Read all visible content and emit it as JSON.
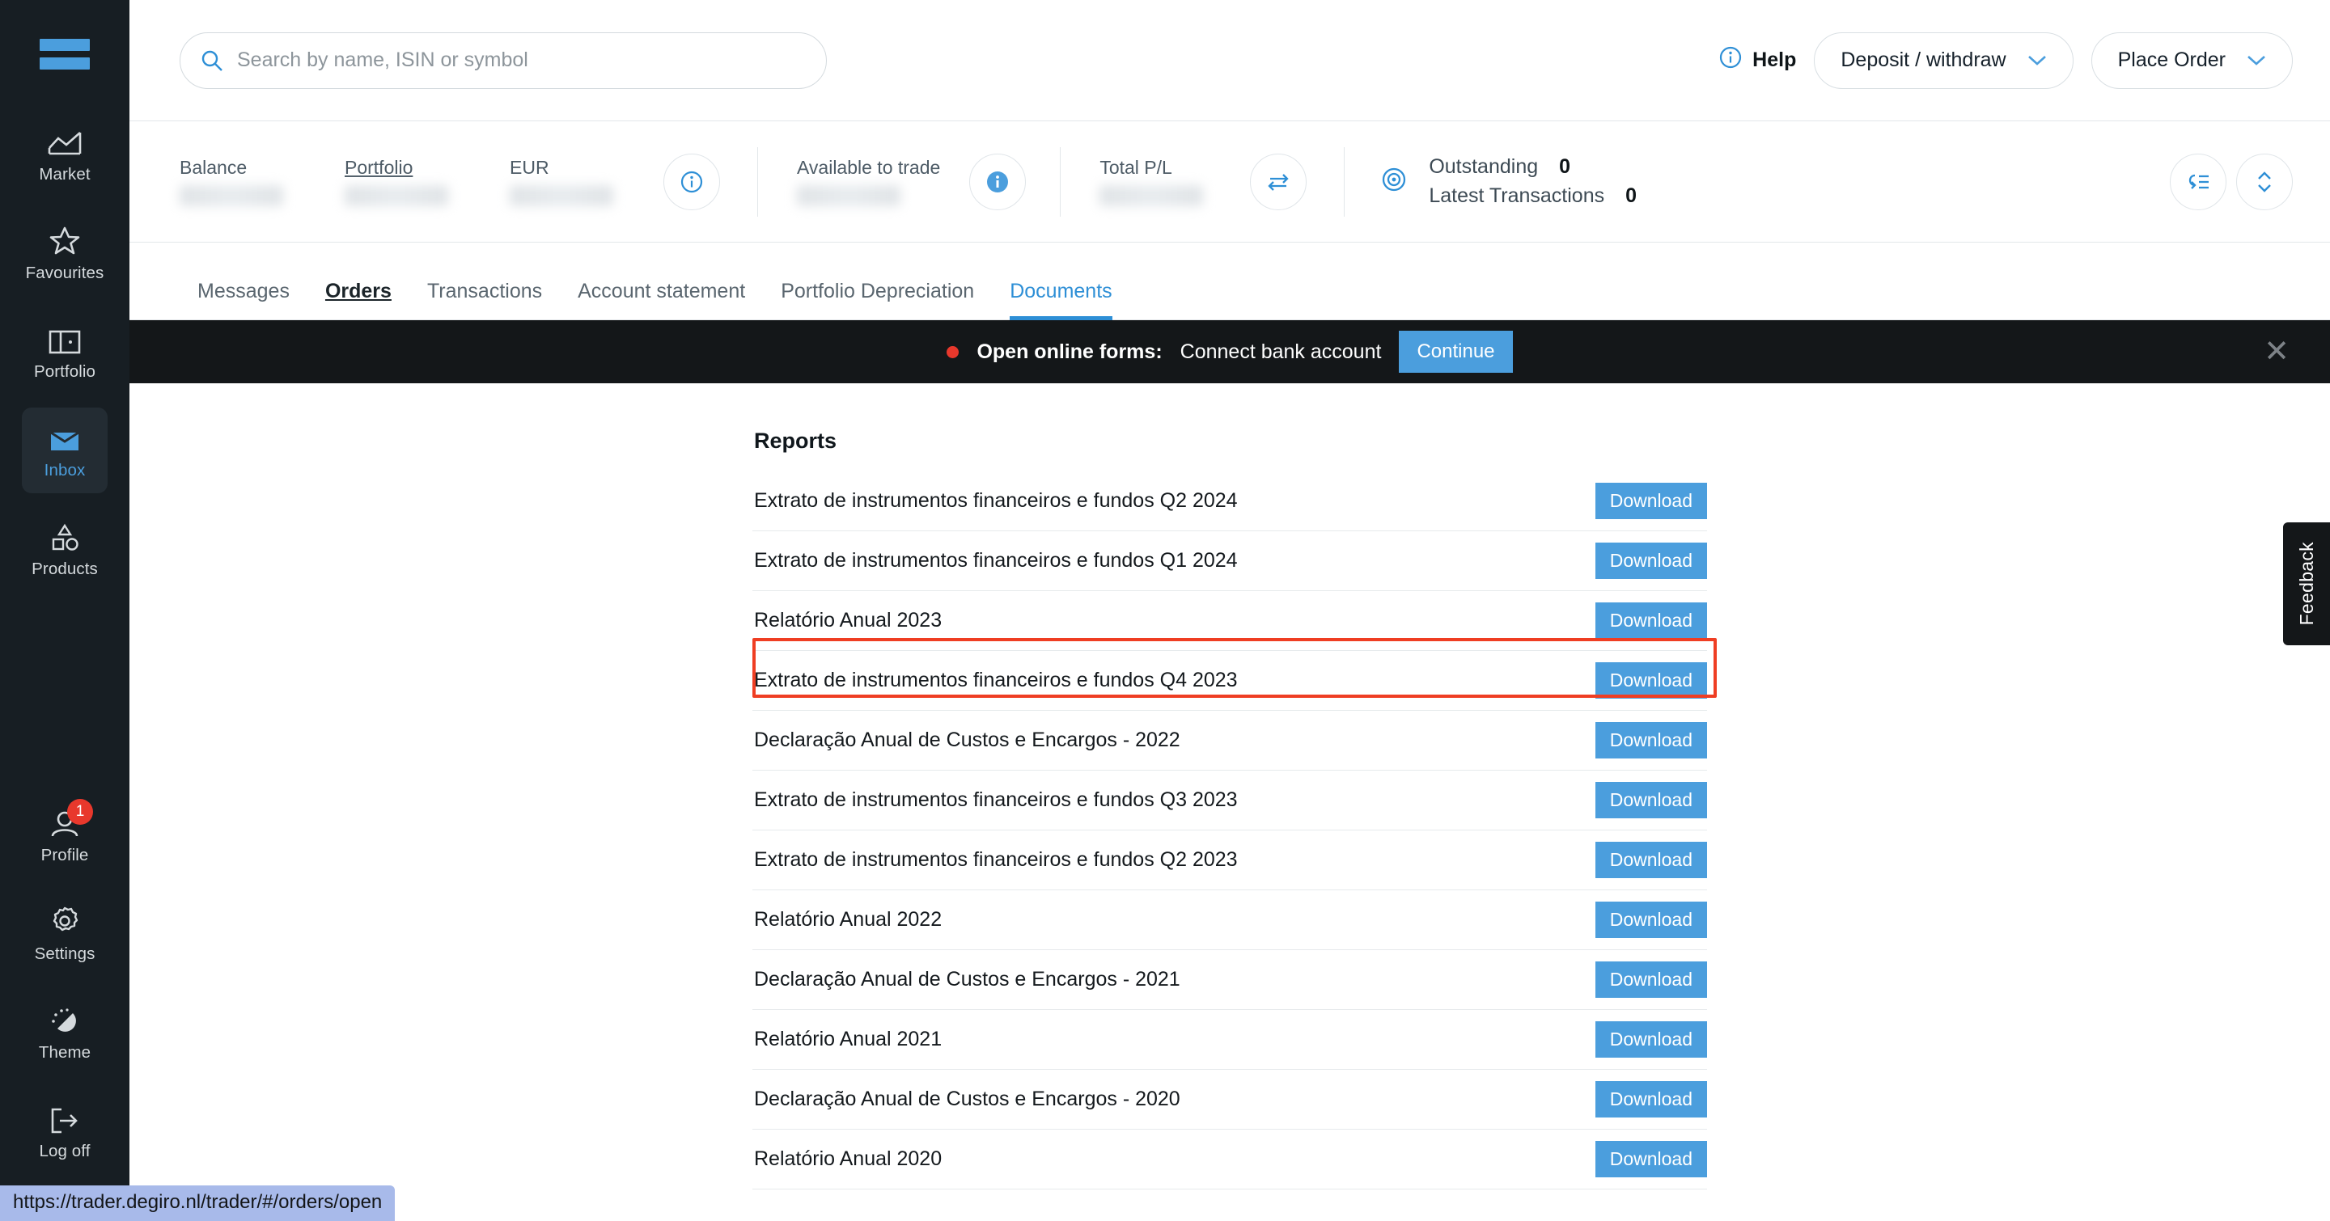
{
  "sidebar": {
    "logo_name": "degiro-logo",
    "top_items": [
      {
        "label": "Market",
        "icon": "market-chart-icon",
        "active": false
      },
      {
        "label": "Favourites",
        "icon": "star-icon",
        "active": false
      },
      {
        "label": "Portfolio",
        "icon": "portfolio-panel-icon",
        "active": false
      },
      {
        "label": "Inbox",
        "icon": "inbox-envelope-icon",
        "active": true
      },
      {
        "label": "Products",
        "icon": "products-shapes-icon",
        "active": false
      }
    ],
    "bottom_items": [
      {
        "label": "Profile",
        "icon": "user-icon",
        "badge": "1",
        "active": false
      },
      {
        "label": "Settings",
        "icon": "gear-icon",
        "active": false
      },
      {
        "label": "Theme",
        "icon": "theme-moon-sun-icon",
        "active": false
      },
      {
        "label": "Log off",
        "icon": "logout-arrow-icon",
        "active": false
      }
    ]
  },
  "header": {
    "search_placeholder": "Search by name, ISIN or symbol",
    "help_label": "Help",
    "deposit_label": "Deposit / withdraw",
    "place_order_label": "Place Order"
  },
  "summary": {
    "balance_label": "Balance",
    "portfolio_label": "Portfolio",
    "currency_label": "EUR",
    "available_label": "Available to trade",
    "total_pl_label": "Total P/L",
    "outstanding_label": "Outstanding",
    "outstanding_value": "0",
    "latest_transactions_label": "Latest Transactions",
    "latest_transactions_value": "0"
  },
  "tabs": [
    {
      "label": "Messages",
      "state": "normal"
    },
    {
      "label": "Orders",
      "state": "visited"
    },
    {
      "label": "Transactions",
      "state": "normal"
    },
    {
      "label": "Account statement",
      "state": "normal"
    },
    {
      "label": "Portfolio Depreciation",
      "state": "normal"
    },
    {
      "label": "Documents",
      "state": "active"
    }
  ],
  "banner": {
    "title": "Open online forms:",
    "text": "Connect bank account",
    "button": "Continue",
    "close_icon": "close-icon"
  },
  "reports": {
    "title": "Reports",
    "download_label": "Download",
    "items": [
      {
        "name": "Extrato de instrumentos financeiros e fundos Q2 2024",
        "highlighted": false
      },
      {
        "name": "Extrato de instrumentos financeiros e fundos Q1 2024",
        "highlighted": false
      },
      {
        "name": "Relatório Anual 2023",
        "highlighted": true
      },
      {
        "name": "Extrato de instrumentos financeiros e fundos Q4 2023",
        "highlighted": false
      },
      {
        "name": "Declaração Anual de Custos e Encargos - 2022",
        "highlighted": false
      },
      {
        "name": "Extrato de instrumentos financeiros e fundos Q3 2023",
        "highlighted": false
      },
      {
        "name": "Extrato de instrumentos financeiros e fundos Q2 2023",
        "highlighted": false
      },
      {
        "name": "Relatório Anual 2022",
        "highlighted": false
      },
      {
        "name": "Declaração Anual de Custos e Encargos - 2021",
        "highlighted": false
      },
      {
        "name": "Relatório Anual 2021",
        "highlighted": false
      },
      {
        "name": "Declaração Anual de Custos e Encargos - 2020",
        "highlighted": false
      },
      {
        "name": "Relatório Anual 2020",
        "highlighted": false
      }
    ]
  },
  "feedback": {
    "label": "Feedback"
  },
  "status_bar": {
    "url": "https://trader.degiro.nl/trader/#/orders/open"
  },
  "colors": {
    "accent_blue": "#4b9edd",
    "tab_active_blue": "#2e8fd6",
    "sidebar_bg": "#171e23",
    "banner_bg": "#141719",
    "alert_red": "#e8382c",
    "highlight_red": "#ef3e23",
    "status_bar_bg": "#a8baea"
  }
}
